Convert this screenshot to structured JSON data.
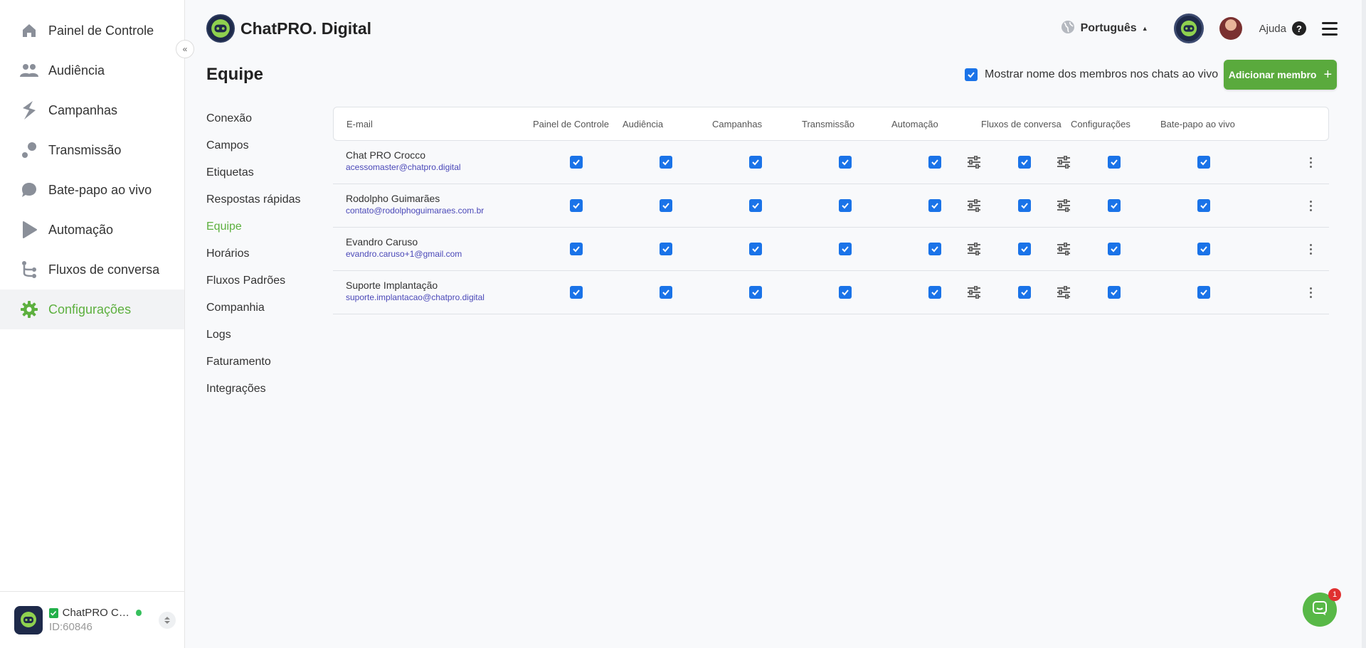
{
  "sidebar": {
    "items": [
      {
        "label": "Painel de Controle",
        "icon": "home-icon"
      },
      {
        "label": "Audiência",
        "icon": "people-icon"
      },
      {
        "label": "Campanhas",
        "icon": "campaign-bolt-icon"
      },
      {
        "label": "Transmissão",
        "icon": "broadcast-icon"
      },
      {
        "label": "Bate-papo ao vivo",
        "icon": "chat-bubble-icon"
      },
      {
        "label": "Automação",
        "icon": "automation-play-icon"
      },
      {
        "label": "Fluxos de conversa",
        "icon": "flow-branch-icon"
      },
      {
        "label": "Configurações",
        "icon": "gear-icon"
      }
    ],
    "active_index": 7,
    "account": {
      "name": "ChatPRO Clie...",
      "id": "ID:60846"
    }
  },
  "header": {
    "brand": "ChatPRO. Digital",
    "language": "Português",
    "help": "Ajuda"
  },
  "page": {
    "title": "Equipe",
    "show_names_label": "Mostrar nome dos membros nos chats ao vivo",
    "show_names_checked": true,
    "add_member_label": "Adicionar membro",
    "add_member_plus": "+"
  },
  "subnav": {
    "items": [
      "Conexão",
      "Campos",
      "Etiquetas",
      "Respostas rápidas",
      "Equipe",
      "Horários",
      "Fluxos Padrões",
      "Companhia",
      "Logs",
      "Faturamento",
      "Integrações"
    ],
    "active_index": 4
  },
  "table": {
    "headers": [
      "E-mail",
      "Painel de Controle",
      "Audiência",
      "Campanhas",
      "Transmissão",
      "Automação",
      "Fluxos de conversa",
      "Configurações",
      "Bate-papo ao vivo"
    ],
    "rows": [
      {
        "name": "Chat PRO Crocco",
        "email": "acessomaster@chatpro.digital",
        "permissions": [
          true,
          true,
          true,
          true,
          true,
          true,
          true,
          true
        ]
      },
      {
        "name": "Rodolpho Guimarães",
        "email": "contato@rodolphoguimaraes.com.br",
        "permissions": [
          true,
          true,
          true,
          true,
          true,
          true,
          true,
          true
        ]
      },
      {
        "name": "Evandro Caruso",
        "email": "evandro.caruso+1@gmail.com",
        "permissions": [
          true,
          true,
          true,
          true,
          true,
          true,
          true,
          true
        ]
      },
      {
        "name": "Suporte Implantação",
        "email": "suporte.implantacao@chatpro.digital",
        "permissions": [
          true,
          true,
          true,
          true,
          true,
          true,
          true,
          true
        ]
      }
    ]
  },
  "chat_widget": {
    "badge": "1"
  },
  "colors": {
    "accent_green": "#5db03f",
    "checkbox_blue": "#1a73e8",
    "email_link": "#4a48b8",
    "dark_navy": "#1e2a4a"
  }
}
